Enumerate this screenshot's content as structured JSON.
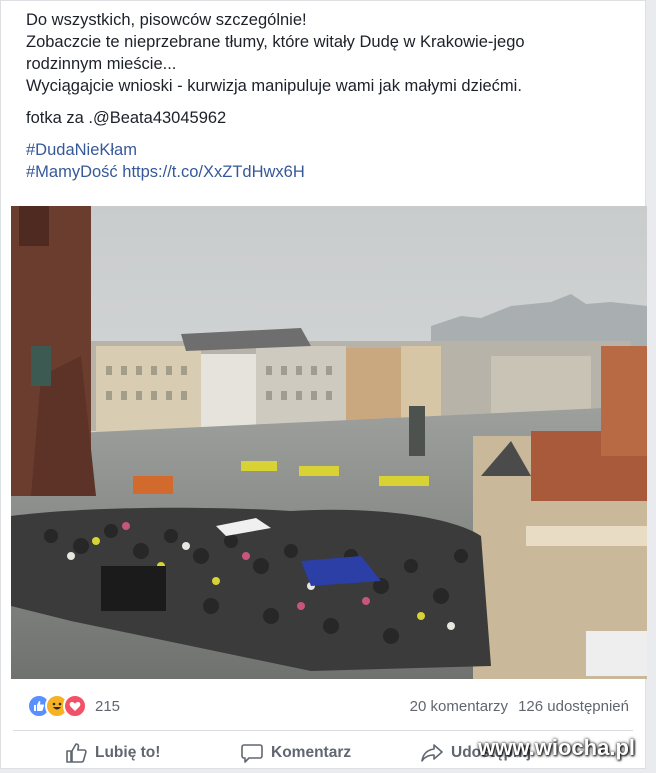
{
  "post": {
    "lines": [
      "Do wszystkich, pisowców szczególnie!",
      "Zobaczcie te nieprzebrane tłumy, które witały Dudę w Krakowie-jego",
      "rodzinnym mieście...",
      "Wyciągajcie wnioski - kurwizja manipuluje wami jak małymi dziećmi."
    ],
    "credit": "fotka za .@Beata43045962",
    "hashtag1": "#DudaNieKłam",
    "hashtag2": "#MamyDość",
    "link": "https://t.co/XxZTdHwx6H"
  },
  "photo": {
    "icon": "crowd-photo"
  },
  "reactions": {
    "count": "215",
    "icons": [
      "like-icon",
      "haha-icon",
      "love-icon"
    ]
  },
  "stats": {
    "comments": "20 komentarzy",
    "shares": "126 udostępnień"
  },
  "actions": {
    "like": "Lubię to!",
    "comment": "Komentarz",
    "share": "Udostępnij"
  },
  "watermark": "www.wiocha.pl",
  "colors": {
    "link": "#365899",
    "like_blue": "#5890ff",
    "love_red": "#f25268",
    "haha_yellow": "#f7b125"
  }
}
